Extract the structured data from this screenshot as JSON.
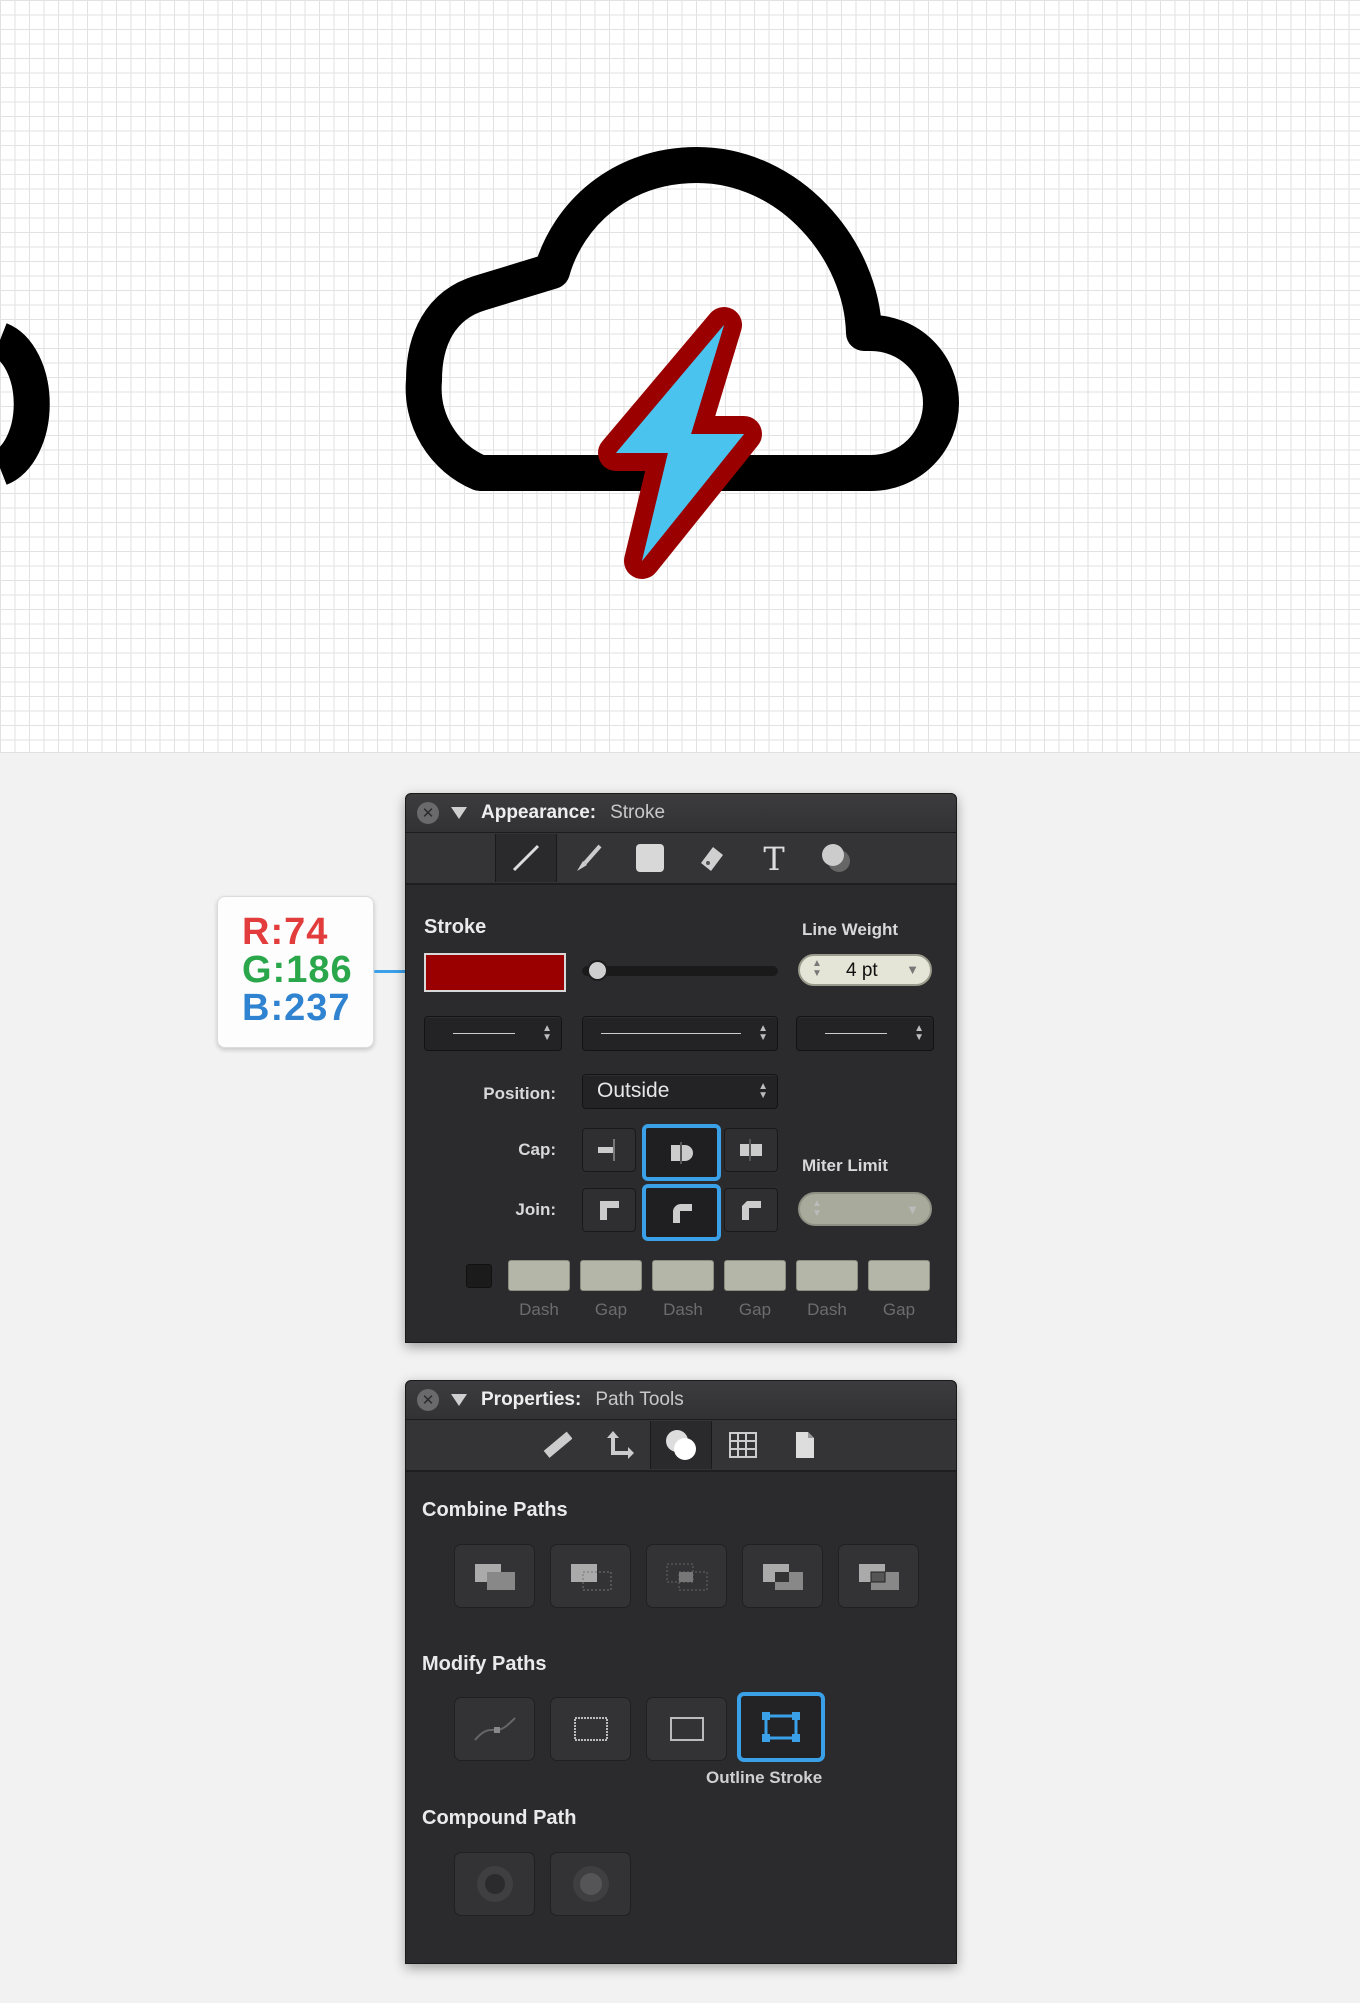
{
  "color_callout": {
    "r": "R:74",
    "g": "G:186",
    "b": "B:237"
  },
  "colors": {
    "stroke_swatch": "#9b0000",
    "bolt_fill": "#4ac4ee",
    "accent": "#3aa0e8"
  },
  "appearance": {
    "title": "Appearance:",
    "subtitle": "Stroke",
    "tools": [
      "line-tool-icon",
      "brush-icon",
      "fill-square-icon",
      "eraser-icon",
      "text-icon",
      "shadow-icon"
    ],
    "stroke_label": "Stroke",
    "line_weight_label": "Line Weight",
    "line_weight_value": "4 pt",
    "position_label": "Position:",
    "position_value": "Outside",
    "cap_label": "Cap:",
    "join_label": "Join:",
    "miter_label": "Miter Limit",
    "dash_labels": [
      "Dash",
      "Gap",
      "Dash",
      "Gap",
      "Dash",
      "Gap"
    ]
  },
  "properties": {
    "title": "Properties:",
    "subtitle": "Path Tools",
    "tools": [
      "ruler-icon",
      "move-arrows-icon",
      "path-combine-icon",
      "grid-icon",
      "document-icon"
    ],
    "combine_label": "Combine Paths",
    "modify_label": "Modify Paths",
    "outline_stroke_label": "Outline Stroke",
    "compound_label": "Compound Path"
  }
}
